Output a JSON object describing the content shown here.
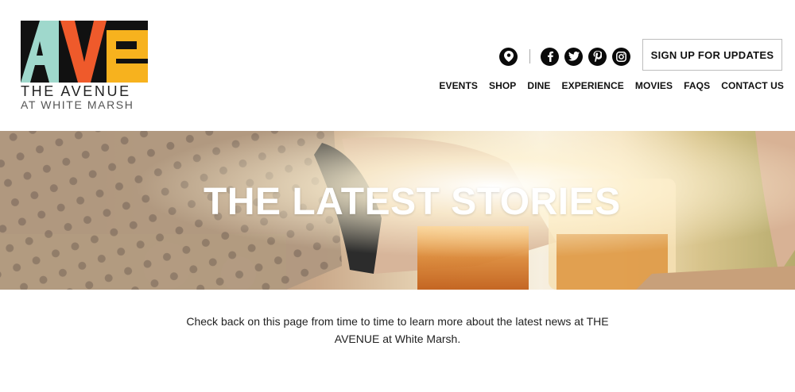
{
  "logo": {
    "mark_text": "AVe",
    "line1": "THE AVENUE",
    "line2": "AT WHITE MARSH",
    "colors": {
      "a": "#9fd8cc",
      "v": "#ef5a2b",
      "e": "#f7b21e",
      "bg": "#111111"
    }
  },
  "header": {
    "icons": [
      "map-pin-icon",
      "facebook-icon",
      "twitter-icon",
      "pinterest-icon",
      "instagram-icon"
    ],
    "signup_label": "SIGN UP FOR UPDATES",
    "nav": [
      "EVENTS",
      "SHOP",
      "DINE",
      "EXPERIENCE",
      "MOVIES",
      "FAQS",
      "CONTACT US"
    ]
  },
  "hero": {
    "title": "THE LATEST STORIES"
  },
  "main": {
    "intro": "Check back on this page from time to time to learn more about the latest news at THE AVENUE at White Marsh."
  }
}
